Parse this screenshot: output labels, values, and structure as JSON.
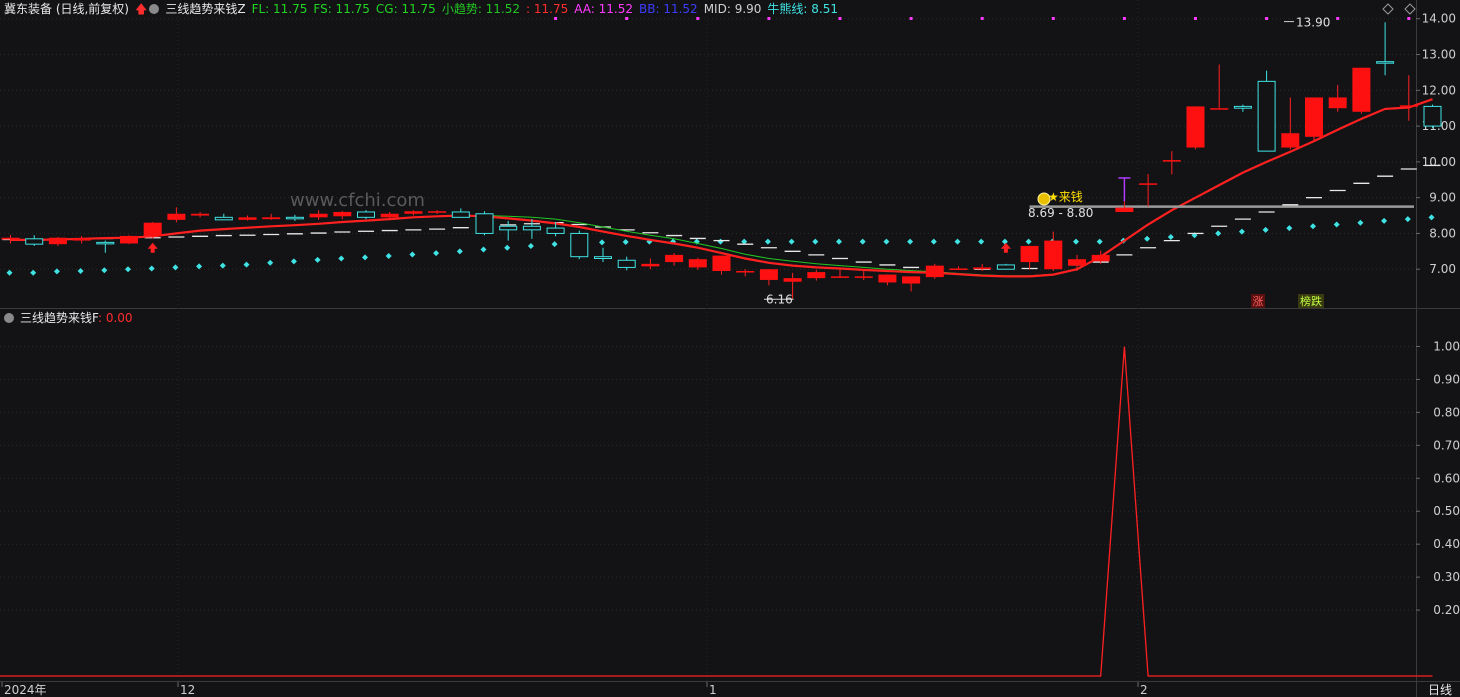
{
  "header_main": {
    "stock": "冀东装备 (日线,前复权)",
    "indicator": "三线趋势来钱Z",
    "items": [
      {
        "label": "FL: 11.75",
        "color": "#22d422"
      },
      {
        "label": "FS: 11.75",
        "color": "#22d422"
      },
      {
        "label": "CG: 11.75",
        "color": "#22d422"
      },
      {
        "label": "小趋势: 11.52",
        "color": "#22c622"
      },
      {
        "label": ": 11.75",
        "color": "#ff2d2d"
      },
      {
        "label": "AA: 11.52",
        "color": "#ff3bff"
      },
      {
        "label": "BB: 11.52",
        "color": "#3c3cff"
      },
      {
        "label": "MID: 9.90",
        "color": "#d0d0d0"
      },
      {
        "label": "牛熊线: 8.51",
        "color": "#3fe3e3"
      }
    ]
  },
  "header_sub": {
    "indicator": "三线趋势来钱F",
    "value": ": 0.00"
  },
  "watermark": "www.cfchi.com",
  "annotations": {
    "high": "13.90",
    "low": "6.16",
    "signal": "来钱",
    "support": "8.69 - 8.80",
    "tag_zhang": "涨",
    "tag_die": "榜跌"
  },
  "x_axis": {
    "labels": [
      "2024年",
      "12",
      "1",
      "2"
    ],
    "period_button": "日线"
  },
  "chart_data": {
    "type": "candlestick",
    "price_axis": {
      "ticks": [
        "14.00",
        "13.00",
        "12.00",
        "11.00",
        "10.00",
        "9.00",
        "8.00",
        "7.00"
      ],
      "ylim": [
        6.0,
        14.3
      ]
    },
    "candles": [
      [
        7.83,
        7.96,
        7.72,
        7.88
      ],
      [
        7.85,
        7.95,
        7.65,
        7.7
      ],
      [
        7.7,
        7.9,
        7.65,
        7.88
      ],
      [
        7.8,
        7.93,
        7.72,
        7.86
      ],
      [
        7.75,
        7.8,
        7.46,
        7.72
      ],
      [
        7.72,
        7.95,
        7.7,
        7.93
      ],
      [
        7.93,
        8.32,
        7.86,
        8.3
      ],
      [
        8.38,
        8.73,
        8.31,
        8.55
      ],
      [
        8.5,
        8.6,
        8.45,
        8.55
      ],
      [
        8.45,
        8.55,
        8.38,
        8.38
      ],
      [
        8.38,
        8.5,
        8.36,
        8.45
      ],
      [
        8.4,
        8.55,
        8.38,
        8.45
      ],
      [
        8.45,
        8.52,
        8.35,
        8.43
      ],
      [
        8.45,
        8.65,
        8.38,
        8.55
      ],
      [
        8.48,
        8.63,
        8.4,
        8.6
      ],
      [
        8.6,
        8.65,
        8.4,
        8.45
      ],
      [
        8.45,
        8.6,
        8.4,
        8.55
      ],
      [
        8.55,
        8.65,
        8.5,
        8.62
      ],
      [
        8.6,
        8.65,
        8.55,
        8.62
      ],
      [
        8.6,
        8.7,
        8.55,
        8.45
      ],
      [
        8.55,
        8.62,
        7.95,
        8.0
      ],
      [
        8.2,
        8.35,
        7.8,
        8.1
      ],
      [
        8.2,
        8.4,
        7.85,
        8.1
      ],
      [
        8.15,
        8.32,
        7.92,
        8.0
      ],
      [
        8.0,
        8.08,
        7.28,
        7.35
      ],
      [
        7.35,
        7.6,
        7.2,
        7.3
      ],
      [
        7.25,
        7.35,
        6.97,
        7.05
      ],
      [
        7.08,
        7.3,
        7.0,
        7.15
      ],
      [
        7.2,
        7.45,
        7.1,
        7.4
      ],
      [
        7.05,
        7.32,
        6.98,
        7.28
      ],
      [
        6.95,
        7.38,
        6.85,
        7.38
      ],
      [
        6.95,
        7.0,
        6.8,
        6.95
      ],
      [
        6.7,
        7.0,
        6.55,
        7.0
      ],
      [
        6.65,
        6.9,
        6.16,
        6.75
      ],
      [
        6.75,
        6.98,
        6.68,
        6.92
      ],
      [
        6.8,
        7.05,
        6.75,
        6.8
      ],
      [
        6.78,
        6.95,
        6.7,
        6.8
      ],
      [
        6.63,
        6.85,
        6.55,
        6.85
      ],
      [
        6.6,
        6.78,
        6.38,
        6.8
      ],
      [
        6.78,
        7.15,
        6.73,
        7.1
      ],
      [
        7.02,
        7.08,
        6.98,
        7.02
      ],
      [
        7.0,
        7.15,
        6.95,
        7.05
      ],
      [
        7.12,
        7.15,
        7.0,
        7.0
      ],
      [
        7.2,
        7.65,
        7.0,
        7.65
      ],
      [
        7.0,
        8.05,
        6.95,
        7.8
      ],
      [
        7.1,
        7.4,
        6.95,
        7.28
      ],
      [
        7.22,
        7.52,
        7.15,
        7.4
      ],
      [
        8.6,
        9.03,
        8.6,
        8.72
      ],
      [
        9.36,
        9.66,
        8.75,
        9.4
      ],
      [
        10.05,
        10.3,
        9.65,
        10.05
      ],
      [
        10.4,
        11.55,
        10.35,
        11.55
      ],
      [
        11.5,
        12.72,
        11.5,
        11.5
      ],
      [
        11.55,
        11.6,
        11.4,
        11.5
      ],
      [
        12.25,
        12.55,
        10.3,
        10.3
      ],
      [
        10.4,
        11.8,
        10.35,
        10.8
      ],
      [
        10.7,
        11.8,
        10.6,
        11.8
      ],
      [
        11.5,
        12.15,
        11.4,
        11.8
      ],
      [
        11.4,
        12.63,
        11.35,
        12.63
      ],
      [
        12.8,
        13.9,
        12.42,
        12.78
      ],
      [
        11.55,
        12.42,
        11.15,
        11.58
      ],
      [
        11.55,
        11.6,
        10.95,
        11.0
      ]
    ],
    "cyan_dots": [
      6.9,
      6.9,
      6.94,
      6.95,
      6.97,
      7.0,
      7.02,
      7.05,
      7.08,
      7.1,
      7.13,
      7.18,
      7.22,
      7.26,
      7.3,
      7.33,
      7.37,
      7.41,
      7.45,
      7.5,
      7.55,
      7.6,
      7.65,
      7.7,
      7.72,
      7.75,
      7.76,
      7.77,
      7.77,
      7.77,
      7.77,
      7.77,
      7.77,
      7.77,
      7.77,
      7.77,
      7.77,
      7.77,
      7.77,
      7.77,
      7.77,
      7.77,
      7.77,
      7.77,
      7.77,
      7.77,
      7.77,
      7.8,
      7.85,
      7.9,
      7.95,
      8.0,
      8.05,
      8.1,
      8.15,
      8.2,
      8.25,
      8.3,
      8.35,
      8.4,
      8.45
    ],
    "mid_dashes": [
      7.83,
      7.84,
      7.84,
      7.85,
      7.86,
      7.87,
      7.88,
      7.9,
      7.92,
      7.94,
      7.95,
      7.97,
      7.99,
      8.01,
      8.04,
      8.06,
      8.08,
      8.1,
      8.12,
      8.16,
      8.2,
      8.24,
      8.27,
      8.3,
      8.25,
      8.18,
      8.1,
      8.02,
      7.94,
      7.86,
      7.8,
      7.7,
      7.6,
      7.5,
      7.4,
      7.3,
      7.2,
      7.12,
      7.05,
      7.02,
      7.0,
      7.0,
      7.01,
      7.02,
      7.06,
      7.12,
      7.2,
      7.4,
      7.6,
      7.8,
      8.0,
      8.2,
      8.4,
      8.6,
      8.8,
      9.0,
      9.2,
      9.4,
      9.6,
      9.8,
      9.9
    ],
    "trend_red": [
      7.82,
      7.82,
      7.83,
      7.85,
      7.87,
      7.88,
      7.92,
      8.0,
      8.08,
      8.12,
      8.16,
      8.2,
      8.23,
      8.27,
      8.32,
      8.36,
      8.4,
      8.45,
      8.48,
      8.5,
      8.48,
      8.42,
      8.36,
      8.28,
      8.18,
      8.05,
      7.93,
      7.82,
      7.72,
      7.6,
      7.45,
      7.3,
      7.18,
      7.1,
      7.05,
      7.02,
      6.98,
      6.95,
      6.92,
      6.9,
      6.86,
      6.82,
      6.8,
      6.8,
      6.85,
      7.0,
      7.35,
      7.8,
      8.25,
      8.65,
      9.0,
      9.35,
      9.7,
      10.0,
      10.28,
      10.58,
      10.9,
      11.2,
      11.48,
      11.52,
      11.75
    ],
    "trend_green": [
      7.82,
      7.82,
      7.83,
      7.85,
      7.87,
      7.88,
      7.92,
      8.0,
      8.08,
      8.12,
      8.16,
      8.2,
      8.23,
      8.27,
      8.32,
      8.36,
      8.4,
      8.45,
      8.48,
      8.5,
      8.5,
      8.48,
      8.45,
      8.4,
      8.3,
      8.18,
      8.06,
      7.95,
      7.85,
      7.72,
      7.58,
      7.42,
      7.3,
      7.22,
      7.15,
      7.1,
      7.05,
      7.0,
      6.96,
      6.93,
      6.88,
      6.84,
      6.82,
      6.82,
      6.86
    ],
    "resistance": {
      "value": 8.75,
      "from_index": 43
    },
    "magenta_dots_from": 23,
    "oscillator": {
      "ylim": [
        0,
        1.05
      ],
      "ticks": [
        "1.00",
        "0.90",
        "0.80",
        "0.70",
        "0.60",
        "0.50",
        "0.40",
        "0.30",
        "0.20"
      ],
      "spike_index": 47,
      "spike_value": 1.0
    }
  }
}
